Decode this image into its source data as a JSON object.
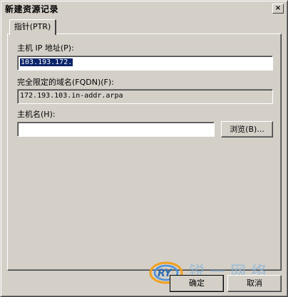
{
  "window": {
    "title": "新建资源记录",
    "close_glyph": "×"
  },
  "tab": {
    "label": "指针(PTR)"
  },
  "host_ip": {
    "label": "主机 IP 地址(P):",
    "value": "103.193.172."
  },
  "fqdn": {
    "label": "完全限定的域名(FQDN)(F):",
    "value": "172.193.103.in-addr.arpa"
  },
  "host_name": {
    "label": "主机名(H):",
    "value": "",
    "browse_label": "浏览(B)..."
  },
  "buttons": {
    "ok": "确定",
    "cancel": "取消"
  },
  "watermark": {
    "logo_text": "RY",
    "brand_text": "锐 一 网 络"
  }
}
